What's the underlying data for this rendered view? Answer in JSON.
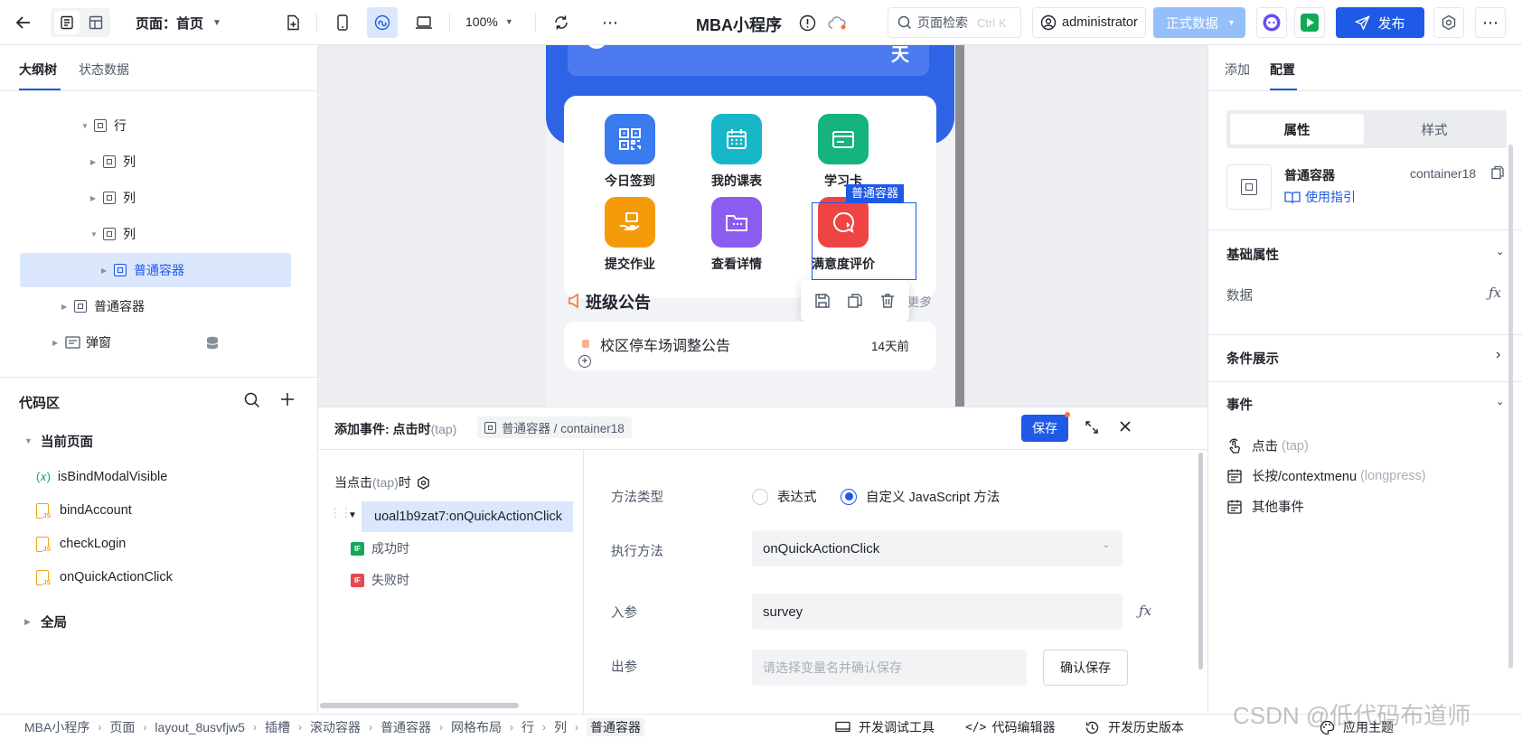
{
  "topbar": {
    "page_label": "页面：首页",
    "zoom": "100%",
    "app_title": "MBA小程序",
    "search_placeholder": "页面检索",
    "search_shortcut": "Ctrl K",
    "user": "administrator",
    "data_env": "正式数据",
    "publish": "发布"
  },
  "left": {
    "tabs": [
      "大纲树",
      "状态数据"
    ],
    "tree": [
      {
        "label": "行",
        "indent": 3,
        "caret": "▾"
      },
      {
        "label": "列",
        "indent": 4,
        "caret": "▸"
      },
      {
        "label": "列",
        "indent": 4,
        "caret": "▸"
      },
      {
        "label": "列",
        "indent": 4,
        "caret": "▾"
      },
      {
        "label": "普通容器",
        "indent": 5,
        "caret": "▸",
        "selected": true
      },
      {
        "label": "普通容器",
        "indent": 2,
        "caret": "▸"
      },
      {
        "label": "弹窗",
        "indent": 1,
        "caret": "▸"
      }
    ],
    "code_title": "代码区",
    "current_page": "当前页面",
    "code_items": [
      {
        "name": "isBindModalVisible",
        "type": "var"
      },
      {
        "name": "bindAccount",
        "type": "js"
      },
      {
        "name": "checkLogin",
        "type": "js"
      },
      {
        "name": "onQuickActionClick",
        "type": "js"
      }
    ],
    "global": "全局"
  },
  "canvas": {
    "quick_actions": [
      {
        "label": "今日签到",
        "color": "#3a7bf0",
        "icon": "qr"
      },
      {
        "label": "我的课表",
        "color": "#18b6c9",
        "icon": "calendar"
      },
      {
        "label": "学习卡",
        "color": "#16b37c",
        "icon": "card"
      },
      {
        "label": "提交作业",
        "color": "#f59a0b",
        "icon": "hand"
      },
      {
        "label": "查看详情",
        "color": "#8a5cf0",
        "icon": "folder"
      },
      {
        "label": "满意度评价",
        "color": "#ef4444",
        "icon": "chat"
      }
    ],
    "selected_tag": "普通容器",
    "notice_title": "班级公告",
    "more": "更多",
    "notice_item": "校区停车场调整公告",
    "notice_time": "14天前",
    "banner_char": "天"
  },
  "event": {
    "title": "添加事件: 点击时",
    "title_tap": "(tap)",
    "path": "普通容器 / container18",
    "save": "保存",
    "when_prefix": "当点击",
    "when_tap": "(tap)",
    "when_suffix": "时",
    "action": "uoal1b9zat7:onQuickActionClick",
    "success": "成功时",
    "fail": "失败时",
    "method_type_label": "方法类型",
    "opt_expr": "表达式",
    "opt_js": "自定义 JavaScript 方法",
    "exec_label": "执行方法",
    "exec_value": "onQuickActionClick",
    "param_label": "入参",
    "param_value": "survey",
    "out_label": "出参",
    "out_placeholder": "请选择变量名并确认保存",
    "confirm": "确认保存"
  },
  "right": {
    "tabs": [
      "添加",
      "配置"
    ],
    "seg": [
      "属性",
      "样式"
    ],
    "comp_name": "普通容器",
    "comp_id": "container18",
    "guide": "使用指引",
    "basic": "基础属性",
    "data_label": "数据",
    "cond": "条件展示",
    "events": "事件",
    "ev1": "点击",
    "ev1_tap": "(tap)",
    "ev2": "长按/contextmenu",
    "ev2_tap": "(longpress)",
    "ev3": "其他事件",
    "theme": "应用主题"
  },
  "status": {
    "crumbs": [
      "MBA小程序",
      "页面",
      "layout_8usvfjw5",
      "插槽",
      "滚动容器",
      "普通容器",
      "网格布局",
      "行",
      "列",
      "普通容器"
    ],
    "devtools": "开发调试工具",
    "code_editor": "代码编辑器",
    "history": "开发历史版本"
  },
  "watermark": "CSDN @低代码布道师",
  "colors": {
    "primary": "#1e5ae6",
    "selected_bg": "#dbe7fd",
    "canvas_bg": "#eceef2"
  }
}
